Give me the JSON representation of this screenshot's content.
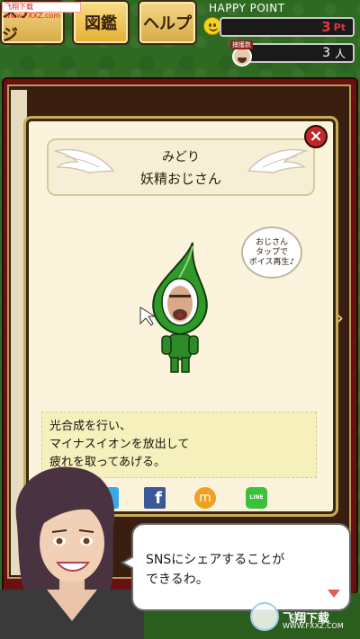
{
  "watermark": {
    "top_text": "飞翔下载 www.FXXZ.com",
    "logo_text": "飞翔下载",
    "logo_url": "WWW.FXXZ.COM"
  },
  "nav": {
    "stage_label": "ステージ",
    "zukan_label": "図鑑",
    "help_label": "ヘルプ"
  },
  "status": {
    "happy_point_label": "HAPPY POINT",
    "happy_point_value": "3",
    "happy_point_unit": "Pt",
    "capture_tag": "捕獲数",
    "capture_value": "3",
    "capture_unit": "人"
  },
  "card": {
    "name_reading": "みどり",
    "name": "妖精おじさん",
    "close_label": "×",
    "voice_hint": [
      "おじさん",
      "タップで",
      "ボイス再生♪"
    ],
    "description": [
      "光合成を行い、",
      "マイナスイオンを放出して",
      "疲れを取ってあげる。"
    ]
  },
  "sns": {
    "facebook_glyph": "f",
    "mixi_glyph": "m",
    "line_glyph": "LINE"
  },
  "navigator": {
    "speech": [
      "SNSにシェアすることが",
      "できるわ。"
    ]
  },
  "colors": {
    "background_green": "#2f6a22",
    "frame_red": "#6a1010",
    "card_cream": "#fbf3dc",
    "point_red": "#e8333d",
    "leaf_green": "#2f9a2a"
  },
  "icons": [
    "smiley-icon",
    "close-icon",
    "twitter-icon",
    "facebook-icon",
    "mixi-icon",
    "line-icon",
    "next-arrow-icon",
    "page-right-icon"
  ]
}
